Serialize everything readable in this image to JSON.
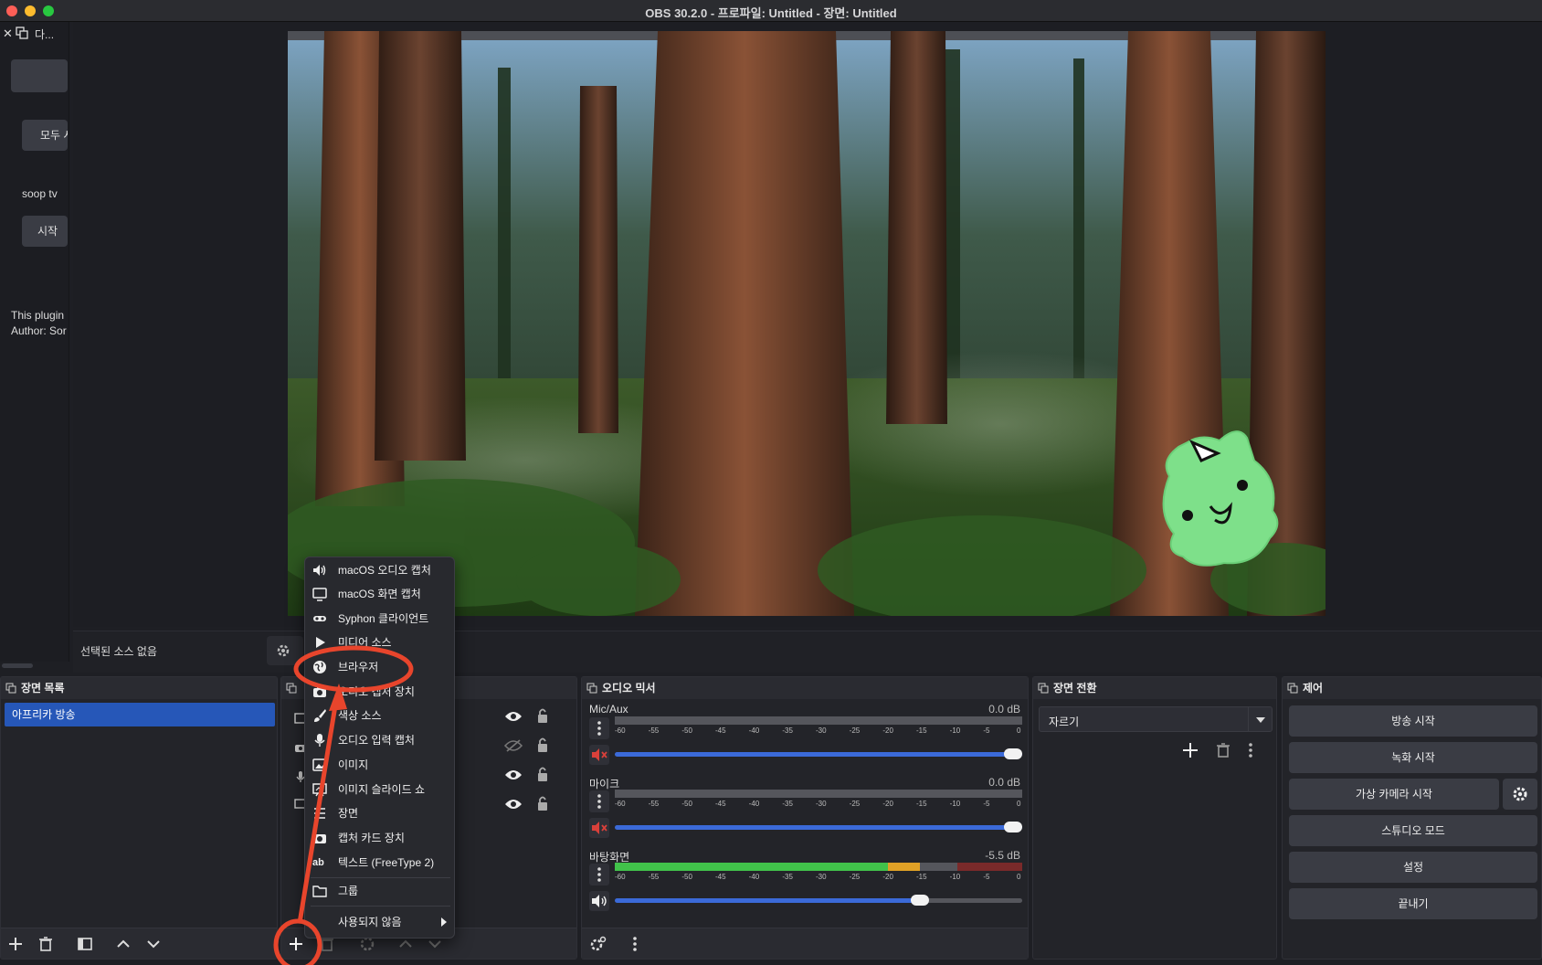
{
  "window": {
    "title": "OBS 30.2.0 - 프로파일: Untitled - 장면: Untitled"
  },
  "left_dock": {
    "tab_label": "다...",
    "all_button": "모두 시",
    "service_label": "soop tv",
    "start_button": "시작",
    "plugin_line1": "This plugin",
    "plugin_line2": "Author: Sor"
  },
  "source_bar": {
    "no_source": "선택된 소스 없음"
  },
  "scenes": {
    "title": "장면 목록",
    "items": [
      "아프리카 방송"
    ]
  },
  "context_menu": {
    "items": [
      {
        "label": "macOS 오디오 캡처",
        "icon": "speaker-icon"
      },
      {
        "label": "macOS 화면 캡처",
        "icon": "monitor-icon"
      },
      {
        "label": "Syphon 클라이언트",
        "icon": "syphon-icon"
      },
      {
        "label": "미디어 소스",
        "icon": "play-icon"
      },
      {
        "label": "브라우저",
        "icon": "globe-icon"
      },
      {
        "label": "오디오 캡처 장치",
        "icon": "camera-icon"
      },
      {
        "label": "색상 소스",
        "icon": "brush-icon"
      },
      {
        "label": "오디오 입력 캡처",
        "icon": "microphone-icon"
      },
      {
        "label": "이미지",
        "icon": "image-icon"
      },
      {
        "label": "이미지 슬라이드 쇼",
        "icon": "slideshow-icon"
      },
      {
        "label": "장면",
        "icon": "scene-icon"
      },
      {
        "label": "캡처 카드 장치",
        "icon": "capture-card-icon"
      },
      {
        "label": "텍스트 (FreeType 2)",
        "icon": "text-icon"
      },
      {
        "label": "그룹",
        "icon": "folder-icon"
      },
      {
        "label": "사용되지 않음",
        "icon": "chevron-right-icon"
      }
    ],
    "text_icon_glyph": "ab"
  },
  "mixer": {
    "title": "오디오 믹서",
    "ticks": [
      "-60",
      "-55",
      "-50",
      "-45",
      "-40",
      "-35",
      "-30",
      "-25",
      "-20",
      "-15",
      "-10",
      "-5",
      "0"
    ],
    "channels": [
      {
        "name": "Mic/Aux",
        "db": "0.0 dB",
        "muted": true,
        "volume": 1.0,
        "level": 0.0
      },
      {
        "name": "마이크",
        "db": "0.0 dB",
        "muted": true,
        "volume": 1.0,
        "level": 0.0
      },
      {
        "name": "바탕화면",
        "db": "-5.5 dB",
        "muted": false,
        "volume": 0.76,
        "level": 0.75
      }
    ]
  },
  "transitions": {
    "title": "장면 전환",
    "selected": "자르기"
  },
  "controls": {
    "title": "제어",
    "start_stream": "방송 시작",
    "start_record": "녹화 시작",
    "virtual_cam": "가상 카메라 시작",
    "studio_mode": "스튜디오 모드",
    "settings": "설정",
    "exit": "끝내기"
  },
  "colors": {
    "accent_blue": "#2657b8",
    "annotation_red": "#e8452c",
    "mascot_green": "#7ee08a"
  }
}
